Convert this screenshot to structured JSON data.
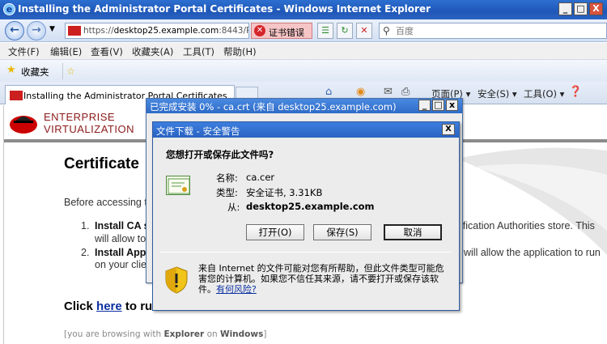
{
  "window": {
    "title": "Installing the Administrator Portal Certificates - Windows Internet Explorer",
    "min_label": "_",
    "max_label": "□",
    "close_label": "X"
  },
  "address_bar": {
    "url_prefix": "https://",
    "url_host": "desktop25.example.com",
    "url_rest": ":8443/RHE",
    "cert_error": "证书错误",
    "search_placeholder": "百度"
  },
  "menu": [
    "文件(F)",
    "编辑(E)",
    "查看(V)",
    "收藏夹(A)",
    "工具(T)",
    "帮助(H)"
  ],
  "favorites": {
    "label": "收藏夹"
  },
  "tab": {
    "title": "Installing the Administrator Portal Certificates"
  },
  "command_bar": {
    "page": "页面(P)",
    "safety": "安全(S)",
    "tools": "工具(O)"
  },
  "page": {
    "brand_line1": "ENTERPRISE",
    "brand_line2": "VIRTUALIZATION",
    "heading": "Certificate",
    "before_text": "Before accessing t",
    "step1_num": "1.",
    "step1_bold": "Install CA s",
    "step1_tail": "ification Authorities store. This",
    "step1_line2": "will allow to",
    "step2_num": "2.",
    "step2_bold": "Install App",
    "step2_tail": "will allow the application to run",
    "step2_line2": "on your clie",
    "click_prefix": "Click ",
    "click_link": "here",
    "click_suffix": " to ru",
    "browsing_pre": "[you are browsing with ",
    "browsing_b1": "Explorer",
    "browsing_mid": " on ",
    "browsing_b2": "Windows",
    "browsing_post": "]"
  },
  "progress_dialog": {
    "title": "已完成安装 0% - ca.crt (来自 desktop25.example.com)"
  },
  "security_dialog": {
    "title": "文件下载 - 安全警告",
    "question": "您想打开或保存此文件吗?",
    "name_label": "名称:",
    "name_value": "ca.cer",
    "type_label": "类型:",
    "type_value": "安全证书, 3.31KB",
    "from_label": "从:",
    "from_value": "desktop25.example.com",
    "open_button": "打开(O)",
    "save_button": "保存(S)",
    "cancel_button": "取消",
    "warning_text": "来自 Internet 的文件可能对您有所帮助，但此文件类型可能危害您的计算机。如果您不信任其来源，请不要打开或保存该软件。",
    "risk_link": "有何风险?"
  }
}
